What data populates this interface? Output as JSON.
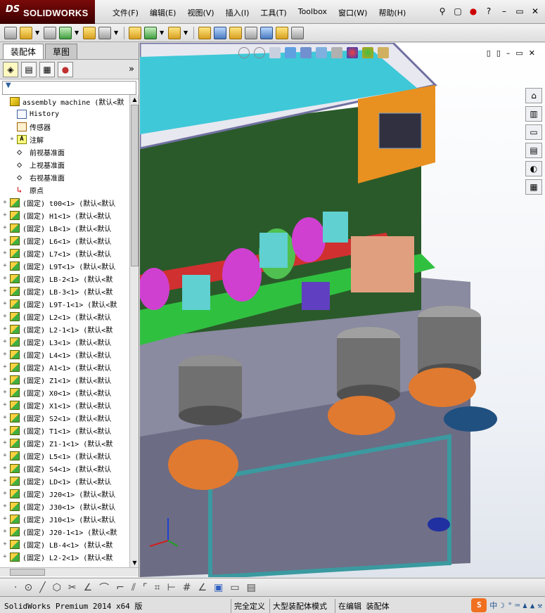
{
  "app": {
    "logo_ds": "DS",
    "logo_name": "SOLIDWORKS"
  },
  "menu": [
    "文件(F)",
    "编辑(E)",
    "视图(V)",
    "插入(I)",
    "工具(T)",
    "Toolbox",
    "窗口(W)",
    "帮助(H)"
  ],
  "menu_right": {
    "help": "?",
    "min": "–",
    "restore": "▭",
    "close": "✕"
  },
  "tabs": {
    "assembly": "装配体",
    "sketch": "草图"
  },
  "panel": {
    "expand": "»",
    "filter": "▼"
  },
  "tree": [
    {
      "label": "assembly machine  (默认<默",
      "icon": "asm",
      "exp": "",
      "indent": 0
    },
    {
      "label": "History",
      "icon": "hist",
      "exp": "",
      "indent": 1
    },
    {
      "label": "传感器",
      "icon": "sens",
      "exp": "",
      "indent": 1
    },
    {
      "label": "注解",
      "icon": "note",
      "exp": "+",
      "indent": 1
    },
    {
      "label": "前视基准面",
      "icon": "plane",
      "exp": "",
      "indent": 1
    },
    {
      "label": "上视基准面",
      "icon": "plane",
      "exp": "",
      "indent": 1
    },
    {
      "label": "右视基准面",
      "icon": "plane",
      "exp": "",
      "indent": 1
    },
    {
      "label": "原点",
      "icon": "org",
      "exp": "",
      "indent": 1
    },
    {
      "label": "(固定) t00<1> (默认<默认",
      "icon": "part",
      "exp": "+",
      "indent": 0
    },
    {
      "label": "(固定) H1<1> (默认<默认",
      "icon": "part",
      "exp": "+",
      "indent": 0
    },
    {
      "label": "(固定) LB<1> (默认<默认",
      "icon": "part",
      "exp": "+",
      "indent": 0
    },
    {
      "label": "(固定) L6<1> (默认<默认",
      "icon": "part",
      "exp": "+",
      "indent": 0
    },
    {
      "label": "(固定) L7<1> (默认<默认",
      "icon": "part",
      "exp": "+",
      "indent": 0
    },
    {
      "label": "(固定) L9T<1> (默认<默认",
      "icon": "part",
      "exp": "+",
      "indent": 0
    },
    {
      "label": "(固定) LB-2<1> (默认<默",
      "icon": "part",
      "exp": "+",
      "indent": 0
    },
    {
      "label": "(固定) LB-3<1> (默认<默",
      "icon": "part",
      "exp": "+",
      "indent": 0
    },
    {
      "label": "(固定) L9T-1<1> (默认<默",
      "icon": "part",
      "exp": "+",
      "indent": 0
    },
    {
      "label": "(固定) L2<1> (默认<默认",
      "icon": "part",
      "exp": "+",
      "indent": 0
    },
    {
      "label": "(固定) L2-1<1> (默认<默",
      "icon": "part",
      "exp": "+",
      "indent": 0
    },
    {
      "label": "(固定) L3<1> (默认<默认",
      "icon": "part",
      "exp": "+",
      "indent": 0
    },
    {
      "label": "(固定) L4<1> (默认<默认",
      "icon": "part",
      "exp": "+",
      "indent": 0
    },
    {
      "label": "(固定) A1<1> (默认<默认",
      "icon": "part",
      "exp": "+",
      "indent": 0
    },
    {
      "label": "(固定) Z1<1> (默认<默认",
      "icon": "part",
      "exp": "+",
      "indent": 0
    },
    {
      "label": "(固定) X0<1> (默认<默认",
      "icon": "part",
      "exp": "+",
      "indent": 0
    },
    {
      "label": "(固定) X1<1> (默认<默认",
      "icon": "part",
      "exp": "+",
      "indent": 0
    },
    {
      "label": "(固定) S2<1> (默认<默认",
      "icon": "part",
      "exp": "+",
      "indent": 0
    },
    {
      "label": "(固定) T1<1> (默认<默认",
      "icon": "part",
      "exp": "+",
      "indent": 0
    },
    {
      "label": "(固定) Z1-1<1> (默认<默",
      "icon": "part",
      "exp": "+",
      "indent": 0
    },
    {
      "label": "(固定) L5<1> (默认<默认",
      "icon": "part",
      "exp": "+",
      "indent": 0
    },
    {
      "label": "(固定) S4<1> (默认<默认",
      "icon": "part",
      "exp": "+",
      "indent": 0
    },
    {
      "label": "(固定) LD<1> (默认<默认",
      "icon": "part",
      "exp": "+",
      "indent": 0
    },
    {
      "label": "(固定) J20<1> (默认<默认",
      "icon": "part",
      "exp": "+",
      "indent": 0
    },
    {
      "label": "(固定) J30<1> (默认<默认",
      "icon": "part",
      "exp": "+",
      "indent": 0
    },
    {
      "label": "(固定) J10<1> (默认<默认",
      "icon": "part",
      "exp": "+",
      "indent": 0
    },
    {
      "label": "(固定) J20-1<1> (默认<默",
      "icon": "part",
      "exp": "+",
      "indent": 0
    },
    {
      "label": "(固定) LB-4<1> (默认<默",
      "icon": "part",
      "exp": "+",
      "indent": 0
    },
    {
      "label": "(固定) L2-2<1> (默认<默",
      "icon": "part",
      "exp": "+",
      "indent": 0
    }
  ],
  "status": {
    "app": "SolidWorks Premium 2014 x64 版",
    "state1": "完全定义",
    "state2": "大型装配体模式",
    "state3": "在编辑 装配体"
  },
  "ime": {
    "logo": "S",
    "lang": "中"
  },
  "colors": {
    "logo_bg": "#6a0000",
    "teal": "#3aa0a0",
    "orange": "#e07a30",
    "green": "#40c040"
  }
}
